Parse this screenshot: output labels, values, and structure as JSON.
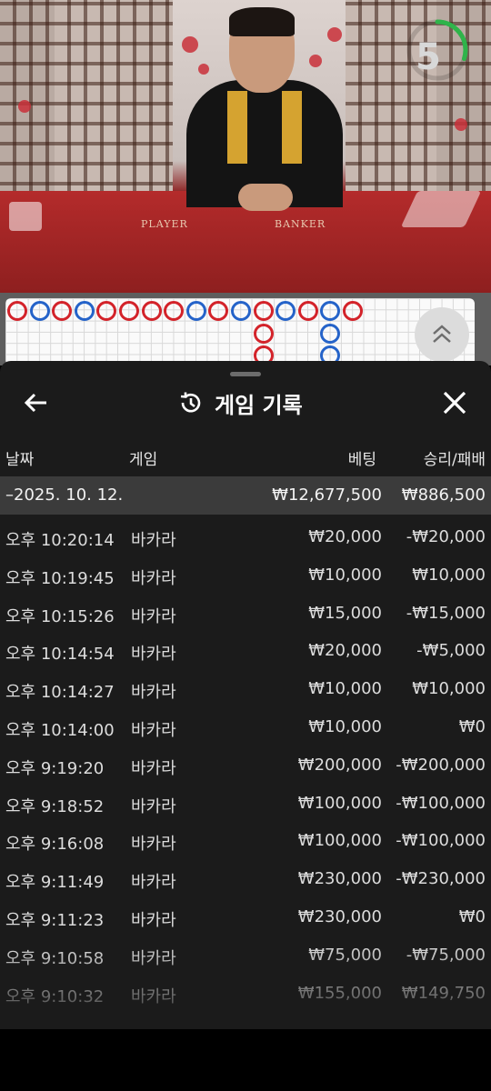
{
  "video": {
    "table_player_label": "PLAYER",
    "table_banker_label": "BANKER",
    "countdown": "5",
    "countdown_progress": 0.3
  },
  "roadmap": {
    "columns": [
      [
        "b"
      ],
      [
        "p"
      ],
      [
        "b"
      ],
      [
        "p"
      ],
      [
        "b"
      ],
      [
        "b"
      ],
      [
        "b"
      ],
      [
        "b"
      ],
      [
        "p"
      ],
      [
        "b"
      ],
      [
        "p"
      ],
      [
        "b",
        "b",
        "b"
      ],
      [
        "p"
      ],
      [
        "b"
      ],
      [
        "p",
        "p",
        "p"
      ],
      [
        "b"
      ]
    ],
    "bead_colors": {
      "b": "#d3232a",
      "p": "#2563c9"
    }
  },
  "sheet": {
    "title": "게임 기록",
    "columns": {
      "date": "날짜",
      "game": "게임",
      "bet": "베팅",
      "winloss": "승리/패배"
    },
    "date_group": {
      "date": "–2025. 10. 12.",
      "bet_total": "₩12,677,500",
      "winloss_total": "₩886,500"
    },
    "rows": [
      {
        "time": "오후 10:20:14",
        "game": "바카라",
        "bet": "₩20,000",
        "winloss": "-₩20,000"
      },
      {
        "time": "오후 10:19:45",
        "game": "바카라",
        "bet": "₩10,000",
        "winloss": "₩10,000"
      },
      {
        "time": "오후 10:15:26",
        "game": "바카라",
        "bet": "₩15,000",
        "winloss": "-₩15,000"
      },
      {
        "time": "오후 10:14:54",
        "game": "바카라",
        "bet": "₩20,000",
        "winloss": "-₩5,000"
      },
      {
        "time": "오후 10:14:27",
        "game": "바카라",
        "bet": "₩10,000",
        "winloss": "₩10,000"
      },
      {
        "time": "오후 10:14:00",
        "game": "바카라",
        "bet": "₩10,000",
        "winloss": "₩0"
      },
      {
        "time": "오후 9:19:20",
        "game": "바카라",
        "bet": "₩200,000",
        "winloss": "-₩200,000"
      },
      {
        "time": "오후 9:18:52",
        "game": "바카라",
        "bet": "₩100,000",
        "winloss": "-₩100,000"
      },
      {
        "time": "오후 9:16:08",
        "game": "바카라",
        "bet": "₩100,000",
        "winloss": "-₩100,000"
      },
      {
        "time": "오후 9:11:49",
        "game": "바카라",
        "bet": "₩230,000",
        "winloss": "-₩230,000"
      },
      {
        "time": "오후 9:11:23",
        "game": "바카라",
        "bet": "₩230,000",
        "winloss": "₩0"
      },
      {
        "time": "오후 9:10:58",
        "game": "바카라",
        "bet": "₩75,000",
        "winloss": "-₩75,000"
      },
      {
        "time": "오후 9:10:32",
        "game": "바카라",
        "bet": "₩155,000",
        "winloss": "₩149,750"
      }
    ]
  }
}
